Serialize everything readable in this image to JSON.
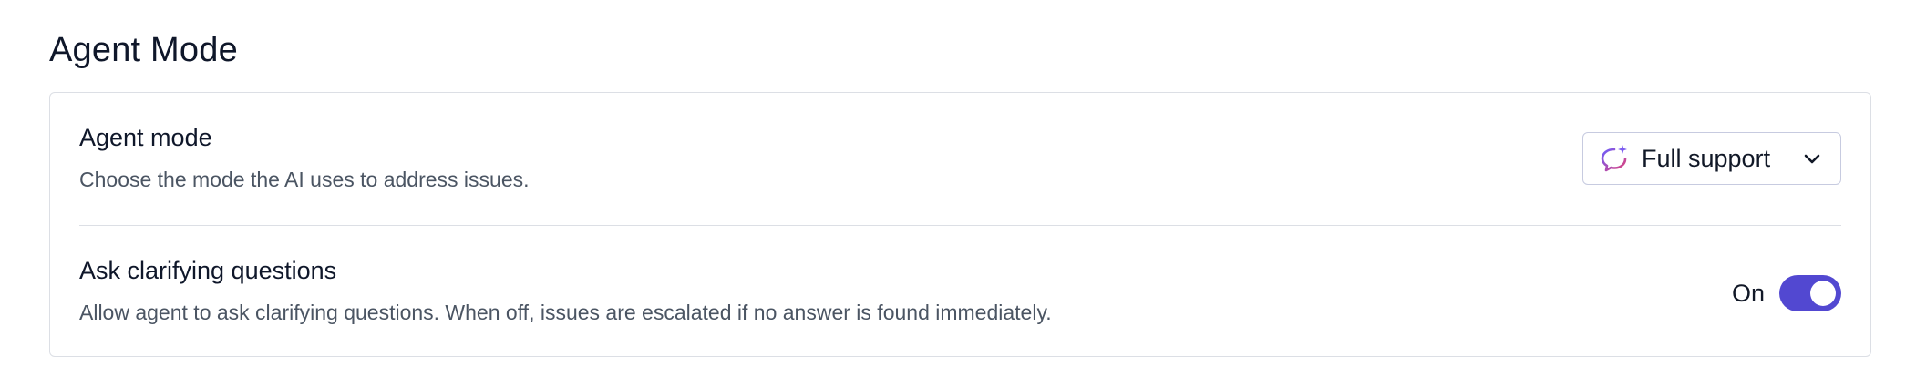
{
  "section": {
    "title": "Agent Mode"
  },
  "agent_mode": {
    "title": "Agent mode",
    "description": "Choose the mode the AI uses to address issues.",
    "selected": "Full support",
    "icon": "chat-sparkle-icon"
  },
  "clarifying_questions": {
    "title": "Ask clarifying questions",
    "description": "Allow agent to ask clarifying questions. When off, issues are escalated if no answer is found immediately.",
    "state_label": "On",
    "enabled": true
  },
  "colors": {
    "toggle_on": "#5248d1",
    "icon_gradient_start": "#6d5dfc",
    "icon_gradient_end": "#e0427a"
  }
}
